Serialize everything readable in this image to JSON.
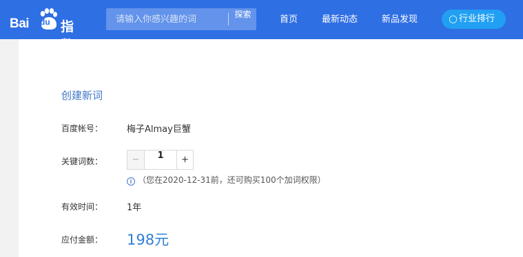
{
  "header": {
    "logo_text_bai": "Bai",
    "logo_text_du": "du",
    "logo_text_zhishu": "指数",
    "search_placeholder": "请输入你感兴趣的词",
    "search_button": "探索",
    "nav": [
      "首页",
      "最新动态",
      "新品发现"
    ],
    "rank_button": "行业排行",
    "rank_icon": "lightbulb-icon"
  },
  "form": {
    "title": "创建新词",
    "account_label": "百度帐号：",
    "account_value": "梅子Almay巨蟹",
    "keyword_count_label": "关键词数：",
    "minus": "−",
    "quantity": "1",
    "plus": "+",
    "info_icon": "i",
    "note": "（您在2020-12-31前，还可购买100个加词权限）",
    "validity_label": "有效时间：",
    "validity_value": "1年",
    "amount_label": "应付金额：",
    "amount_value": "198元"
  },
  "colors": {
    "header_bg": "#2f6fe4",
    "rank_button_bg": "#21a0f3",
    "accent_text": "#3f77c9",
    "price": "#2f7fd6"
  }
}
